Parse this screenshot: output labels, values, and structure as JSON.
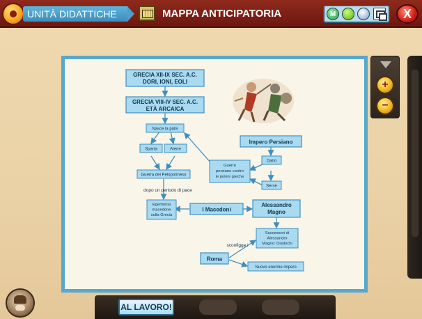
{
  "header": {
    "breadcrumb": "UNITÀ DIDATTICHE",
    "section_title": "MAPPA ANTICIPATORIA",
    "tools": [
      "m-icon",
      "frog-icon",
      "zoom-search-icon",
      "window-icon"
    ],
    "tool_m_label": "M",
    "close_label": "X"
  },
  "concept_map": {
    "nodes": {
      "grecia_xii": [
        "GRECIA XII-IX SEC. A.C.",
        "DORI, IONI, EOLI"
      ],
      "grecia_viii": [
        "GRECIA VIII-IV SEC. A.C.",
        "ETÀ ARCAICA"
      ],
      "polis": [
        "Nasce la polis"
      ],
      "sparta": [
        "Sparta"
      ],
      "atene": [
        "Atene"
      ],
      "peloponneso": [
        "Guerra del Peloponneso"
      ],
      "egemonia": [
        "Egemonia",
        "macedone",
        "sulla Grecia"
      ],
      "impero_persiano": [
        "Impero Persiano"
      ],
      "guerre_persiane": [
        "Guerre",
        "persiane contro",
        "le poleis greche"
      ],
      "dario": [
        "Dario"
      ],
      "serse": [
        "Serse"
      ],
      "macedoni": [
        "I Macedoni"
      ],
      "alessandro": [
        "Alessandro",
        "Magno"
      ],
      "successori": [
        "Successori di",
        "Alessandro",
        "Magno: Diadochi"
      ],
      "roma": [
        "Roma"
      ],
      "nuovo_impero": [
        "Nuovo enorme impero"
      ]
    },
    "edge_labels": {
      "pace": "dopo un periodo di pace",
      "sconfigge": "sconfigge i"
    },
    "colors": {
      "node_fill": "#a9daf0",
      "node_border": "#3f8fbe",
      "text": "#0f3550",
      "arrow": "#3f8fbe"
    }
  },
  "zoom": {
    "in_label": "+",
    "out_label": "−"
  },
  "footer": {
    "work_button": "AL LAVORO!"
  }
}
